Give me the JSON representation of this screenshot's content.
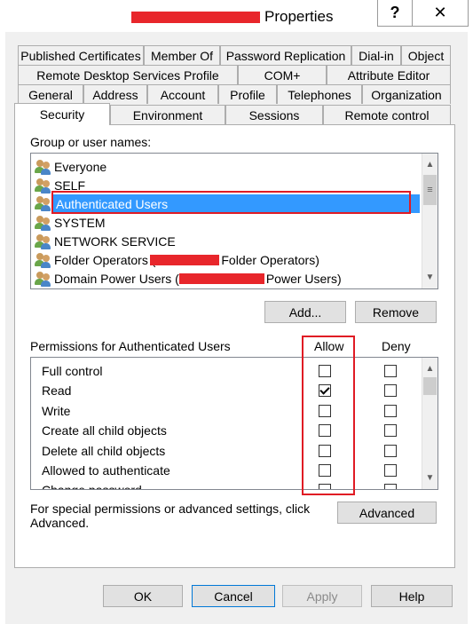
{
  "window": {
    "title": "Properties",
    "help_glyph": "?",
    "close_glyph": "✕"
  },
  "tabs": {
    "row1": [
      "Published Certificates",
      "Member Of",
      "Password Replication",
      "Dial-in",
      "Object"
    ],
    "row2": [
      "Remote Desktop Services Profile",
      "COM+",
      "Attribute Editor"
    ],
    "row3": [
      "General",
      "Address",
      "Account",
      "Profile",
      "Telephones",
      "Organization"
    ],
    "row4": [
      "Security",
      "Environment",
      "Sessions",
      "Remote control"
    ],
    "active": "Security"
  },
  "groups": {
    "label": "Group or user names:",
    "items": [
      {
        "name": "Everyone"
      },
      {
        "name": "SELF"
      },
      {
        "name": "Authenticated Users",
        "selected": true
      },
      {
        "name": "SYSTEM"
      },
      {
        "name": "NETWORK SERVICE"
      },
      {
        "name_prefix": "Folder Operators (",
        "name_suffix": "Folder Operators)"
      },
      {
        "name_prefix": "Domain Power Users (",
        "name_suffix": "Power Users)"
      }
    ],
    "add_label": "Add...",
    "remove_label": "Remove"
  },
  "permissions": {
    "label": "Permissions for Authenticated Users",
    "allow_label": "Allow",
    "deny_label": "Deny",
    "rows": [
      {
        "name": "Full control",
        "allow": false,
        "deny": false
      },
      {
        "name": "Read",
        "allow": true,
        "deny": false
      },
      {
        "name": "Write",
        "allow": false,
        "deny": false
      },
      {
        "name": "Create all child objects",
        "allow": false,
        "deny": false
      },
      {
        "name": "Delete all child objects",
        "allow": false,
        "deny": false
      },
      {
        "name": "Allowed to authenticate",
        "allow": false,
        "deny": false
      },
      {
        "name": "Change password",
        "allow": false,
        "deny": false
      }
    ]
  },
  "advanced": {
    "text_line1": "For special permissions or advanced settings, click",
    "text_line2": "Advanced.",
    "button_label": "Advanced"
  },
  "footer": {
    "ok_label": "OK",
    "cancel_label": "Cancel",
    "apply_label": "Apply",
    "help_label": "Help"
  },
  "colors": {
    "selection": "#3399ff",
    "annotation_red": "#e01b24",
    "redaction_red": "#e8262b"
  }
}
